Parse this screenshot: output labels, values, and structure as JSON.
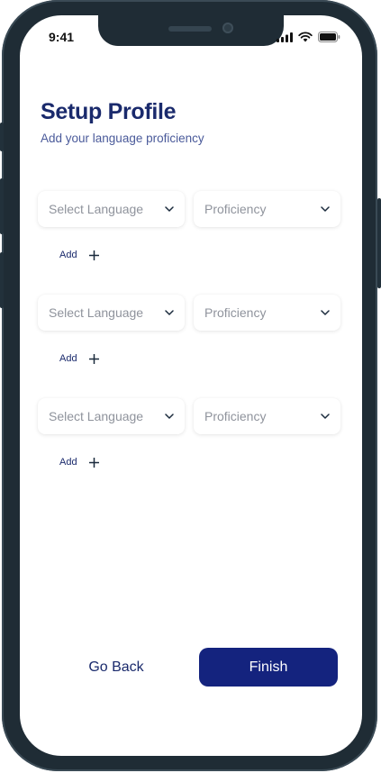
{
  "status_bar": {
    "time": "9:41",
    "icons": [
      "signal-icon",
      "wifi-icon",
      "battery-icon"
    ]
  },
  "header": {
    "title": "Setup Profile",
    "subtitle": "Add your language proficiency"
  },
  "language_rows": [
    {
      "language_placeholder": "Select Language",
      "proficiency_placeholder": "Proficiency",
      "add_label": "Add"
    },
    {
      "language_placeholder": "Select Language",
      "proficiency_placeholder": "Proficiency",
      "add_label": "Add"
    },
    {
      "language_placeholder": "Select Language",
      "proficiency_placeholder": "Proficiency",
      "add_label": "Add"
    }
  ],
  "footer": {
    "back_label": "Go Back",
    "finish_label": "Finish"
  },
  "colors": {
    "primary": "#14237e",
    "title": "#1a2a6c",
    "frame": "#1f2c35"
  }
}
